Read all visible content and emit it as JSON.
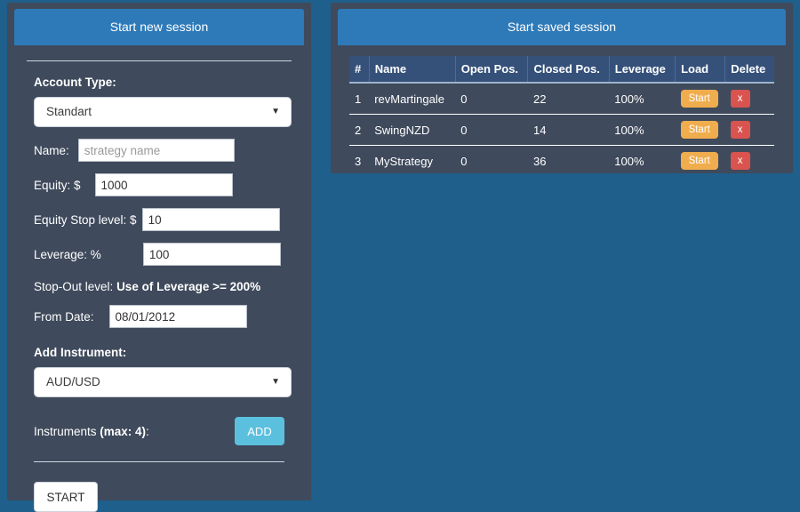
{
  "theme": {
    "page_bg": "#1f5f8b",
    "panel_bg": "#3f4a5c",
    "header_bg": "#2e7ab8",
    "accent_add": "#5bc0de",
    "accent_start_row": "#f0ad4e",
    "accent_delete": "#d9534f",
    "table_header_bg": "#35517a"
  },
  "new_session": {
    "header_title": "Start new session",
    "account_type_label": "Account Type:",
    "account_type_value": "Standart",
    "name_label": "Name:",
    "name_placeholder": "strategy name",
    "name_value": "",
    "equity_label": "Equity: $",
    "equity_value": "1000",
    "equity_stop_label": "Equity Stop level: $",
    "equity_stop_value": "10",
    "leverage_label": "Leverage: %",
    "leverage_value": "100",
    "stopout_label": "Stop-Out level:",
    "stopout_value": "Use of Leverage >= 200%",
    "from_date_label": "From Date:",
    "from_date_value": "08/01/2012",
    "add_instrument_label": "Add Instrument:",
    "instrument_value": "AUD/USD",
    "instruments_label_prefix": "Instruments ",
    "instruments_label_bold": "(max: 4)",
    "instruments_label_suffix": ":",
    "add_button_label": "ADD",
    "start_button_label": "START",
    "caret_glyph": "▼"
  },
  "saved_session": {
    "header_title": "Start saved session",
    "columns": [
      "#",
      "Name",
      "Open Pos.",
      "Closed Pos.",
      "Leverage",
      "Load",
      "Delete"
    ],
    "rows": [
      {
        "idx": "1",
        "name": "revMartingale",
        "open": "0",
        "closed": "22",
        "leverage": "100%",
        "load": "Start",
        "delete": "x"
      },
      {
        "idx": "2",
        "name": "SwingNZD",
        "open": "0",
        "closed": "14",
        "leverage": "100%",
        "load": "Start",
        "delete": "x"
      },
      {
        "idx": "3",
        "name": "MyStrategy",
        "open": "0",
        "closed": "36",
        "leverage": "100%",
        "load": "Start",
        "delete": "x"
      }
    ]
  }
}
